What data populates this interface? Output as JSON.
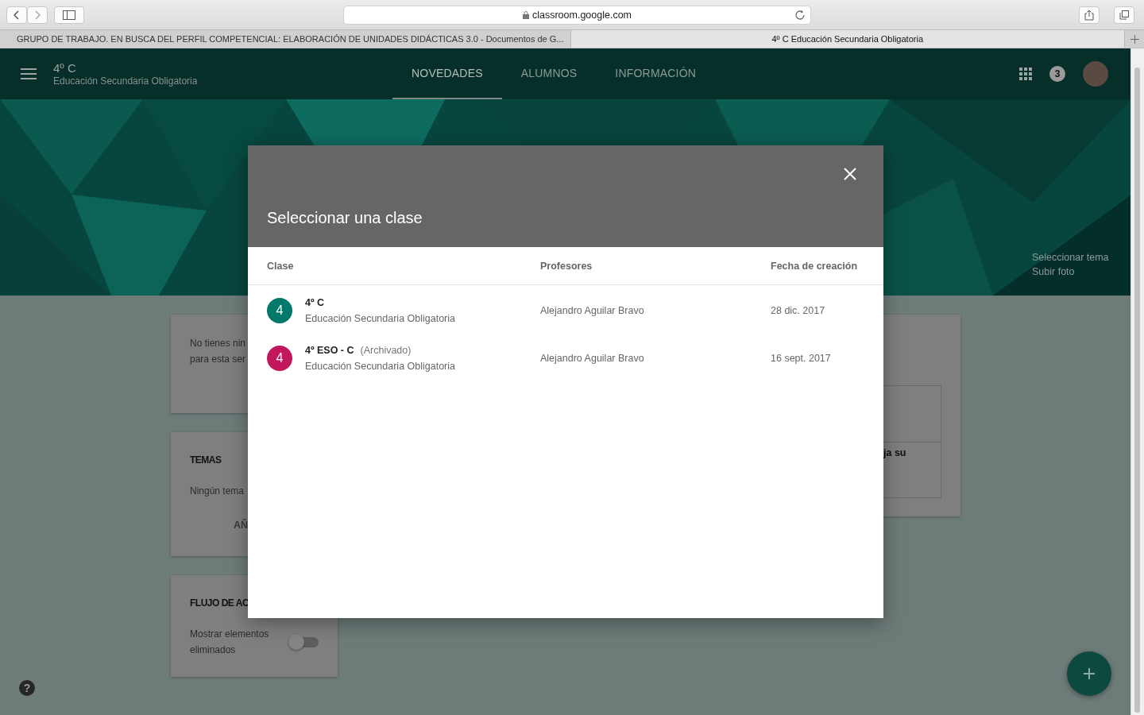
{
  "browser": {
    "address": "classroom.google.com",
    "tabs": [
      {
        "title": "GRUPO DE TRABAJO. EN BUSCA DEL PERFIL COMPETENCIAL: ELABORACIÓN DE UNIDADES DIDÁCTICAS 3.0 - Documentos de G...",
        "selected": false
      },
      {
        "title": "4º C Educación Secundaria Obligatoria",
        "selected": true
      }
    ]
  },
  "header": {
    "title": "4º C",
    "subtitle": "Educación Secundaria Obligatoria",
    "tabs": [
      {
        "label": "NOVEDADES",
        "selected": true
      },
      {
        "label": "ALUMNOS",
        "selected": false
      },
      {
        "label": "INFORMACIÓN",
        "selected": false
      }
    ],
    "notifications": "3"
  },
  "banner": {
    "links": [
      "Seleccionar tema",
      "Subir foto"
    ]
  },
  "cards": {
    "upcoming": [
      "No tienes nin",
      "para esta ser"
    ],
    "topics": {
      "title": "TEMAS",
      "text": "Ningún tema",
      "button": "AÑ"
    },
    "stream": {
      "title": "FLUJO DE AC",
      "setting": "Mostrar elementos eliminados",
      "on": false
    },
    "main_fragment": "ja su"
  },
  "help": "?",
  "dialog": {
    "title": "Seleccionar una clase",
    "columns": [
      "Clase",
      "Profesores",
      "Fecha de creación"
    ],
    "rows": [
      {
        "initial": "4",
        "color": "#00796b",
        "name": "4º C",
        "status": "",
        "section": "Educación Secundaria Obligatoria",
        "teacher": "Alejandro Aguilar Bravo",
        "date": "28 dic. 2017"
      },
      {
        "initial": "4",
        "color": "#c2185b",
        "name": "4º ESO - C",
        "status": "(Archivado)",
        "section": "Educación Secundaria Obligatoria",
        "teacher": "Alejandro Aguilar Bravo",
        "date": "16 sept. 2017"
      }
    ]
  }
}
